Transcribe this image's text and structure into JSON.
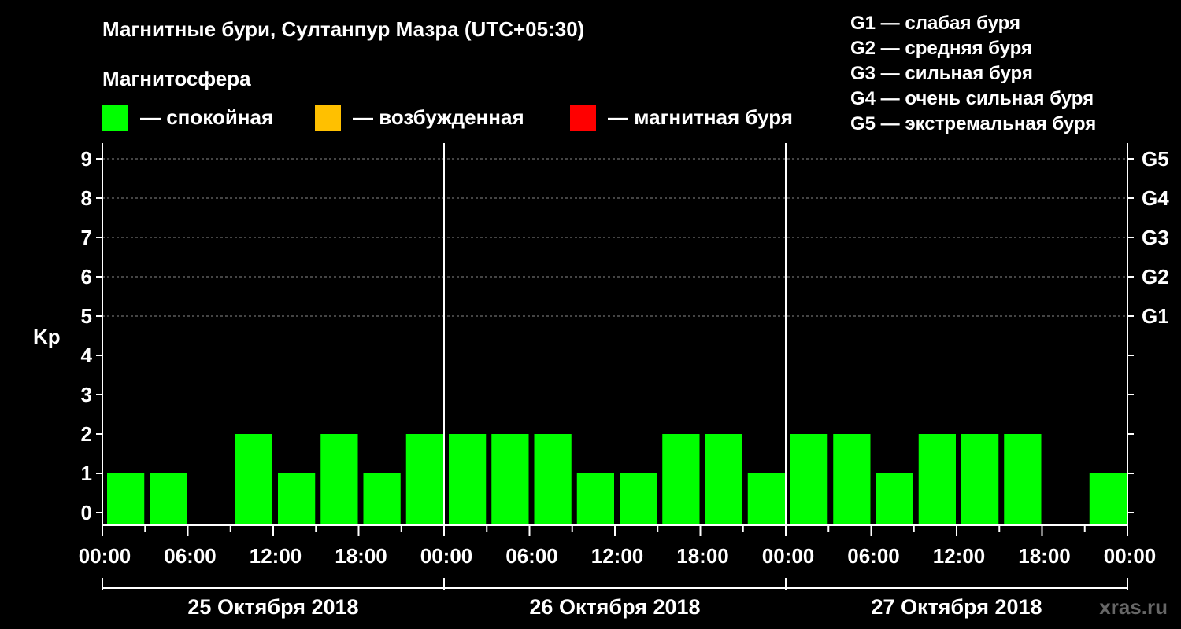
{
  "title": "Магнитные бури, Султанпур Мазра (UTC+05:30)",
  "magnetosphere_label": "Магнитосфера",
  "legend": [
    {
      "label": "— спокойная",
      "color": "#00ff00"
    },
    {
      "label": "— возбужденная",
      "color": "#ffc000"
    },
    {
      "label": "— магнитная буря",
      "color": "#ff0000"
    }
  ],
  "g_levels": [
    "G1 — слабая буря",
    "G2 — средняя буря",
    "G3 — сильная буря",
    "G4 — очень сильная буря",
    "G5 — экстремальная буря"
  ],
  "watermark": "xras.ru",
  "chart_data": {
    "type": "bar",
    "ylabel": "Kp",
    "ylim": [
      0,
      9
    ],
    "yticks": [
      0,
      1,
      2,
      3,
      4,
      5,
      6,
      7,
      8,
      9
    ],
    "right_axis_labels": [
      {
        "kp": 5,
        "label": "G1"
      },
      {
        "kp": 6,
        "label": "G2"
      },
      {
        "kp": 7,
        "label": "G3"
      },
      {
        "kp": 8,
        "label": "G4"
      },
      {
        "kp": 9,
        "label": "G5"
      }
    ],
    "grid": "dashed horizontal at Kp 5-9",
    "x_tick_labels": [
      "00:00",
      "06:00",
      "12:00",
      "18:00",
      "00:00",
      "06:00",
      "12:00",
      "18:00",
      "00:00",
      "06:00",
      "12:00",
      "18:00",
      "00:00"
    ],
    "days": [
      "25 Октября 2018",
      "26 Октября 2018",
      "27 Октября 2018"
    ],
    "interval_hours": 3,
    "values": [
      1,
      1,
      0,
      2,
      1,
      2,
      1,
      2,
      2,
      2,
      2,
      1,
      1,
      2,
      2,
      1,
      2,
      2,
      1,
      2,
      2,
      2,
      0,
      1
    ],
    "bar_color": "#00ff00"
  }
}
